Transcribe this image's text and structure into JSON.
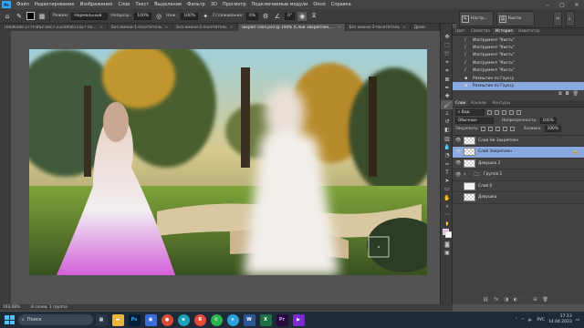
{
  "menu": {
    "logo": "Ps",
    "items": [
      "Файл",
      "Редактирование",
      "Изображение",
      "Слои",
      "Текст",
      "Выделение",
      "Фильтр",
      "3D",
      "Просмотр",
      "Подключаемые модули",
      "Окно",
      "Справка"
    ]
  },
  "options": {
    "mode_label": "Режим:",
    "mode_value": "Нормальный",
    "opacity_label": "Непрозр.:",
    "opacity_value": "100%",
    "pressure_label": "Наж.:",
    "pressure_value": "100%",
    "smoothing_label": "Сглаживание:",
    "smoothing_value": "0%",
    "angle_value": "0°"
  },
  "top_right": {
    "panel1_label": "Настр...",
    "panel2_label": "Кисти"
  },
  "doc_tabs": [
    {
      "label": "706d65de-277f-4fa2-a8c7-232d95b11d27-посетитель...jpeg",
      "active": false
    },
    {
      "label": "Без имени-1-посетитель",
      "active": false
    },
    {
      "label": "Без имени-2-посетитель",
      "active": false
    },
    {
      "label": "закреп слоя.psd @ 194% (Слой Закреплен, RGB/8)",
      "active": true
    },
    {
      "label": "Без имени-3-посетитель",
      "active": false
    },
    {
      "label": "Дрем",
      "active": false
    }
  ],
  "history_panel": {
    "tabs": [
      "Цвет",
      "Свойства",
      "История",
      "Навигатор"
    ],
    "active_tab": "История",
    "items": [
      {
        "label": "Инструмент \"Кисть\"",
        "active": false
      },
      {
        "label": "Инструмент \"Кисть\"",
        "active": false
      },
      {
        "label": "Инструмент \"Кисть\"",
        "active": false
      },
      {
        "label": "Инструмент \"Кисть\"",
        "active": false
      },
      {
        "label": "Инструмент \"Кисть\"",
        "active": false
      },
      {
        "label": "Размытие по Гауссу",
        "active": false
      },
      {
        "label": "Размытие по Гауссу",
        "active": true
      }
    ]
  },
  "layers_panel": {
    "tabs": [
      "Слои",
      "Каналы",
      "Контуры"
    ],
    "active_tab": "Слои",
    "kind_label": "Вид",
    "blend_mode": "Обычные",
    "opacity_label": "Непрозрачность:",
    "opacity_value": "100%",
    "lock_label": "Закрепить:",
    "fill_label": "Заливка:",
    "fill_value": "100%",
    "layers": [
      {
        "name": "Слой Не Закреплен",
        "visible": true,
        "active": false,
        "type": "layer"
      },
      {
        "name": "Слой Закреплен",
        "visible": true,
        "active": true,
        "type": "layer",
        "locked": true
      },
      {
        "name": "Девушка 2",
        "visible": true,
        "active": false,
        "type": "layer"
      },
      {
        "name": "Группа 1",
        "visible": true,
        "active": false,
        "type": "group"
      },
      {
        "name": "Слой 0",
        "visible": false,
        "active": false,
        "type": "layer",
        "white": true
      },
      {
        "name": "Девушка",
        "visible": false,
        "active": false,
        "type": "layer"
      }
    ]
  },
  "status": {
    "zoom": "193,68%",
    "info": "8 слоев, 1 группа"
  },
  "taskbar": {
    "search_label": "Поиск",
    "lang": "РУС",
    "time": "17:13",
    "date": "14.04.2023"
  },
  "colors": {
    "foreground": "#f0b4f0",
    "background": "#ffffff",
    "selection": "#8aa8e0"
  }
}
